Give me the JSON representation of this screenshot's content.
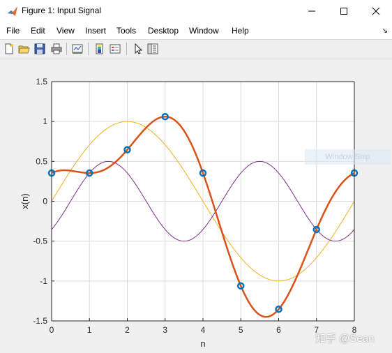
{
  "window": {
    "title": "Figure 1: Input Signal",
    "app_icon": "matlab-icon",
    "controls": [
      "minimize-icon",
      "maximize-icon",
      "close-icon"
    ]
  },
  "menu": {
    "items": [
      "File",
      "Edit",
      "View",
      "Insert",
      "Tools",
      "Desktop",
      "Window",
      "Help"
    ],
    "corner_glyph": "↘"
  },
  "toolbar": {
    "buttons": [
      "new-figure-icon",
      "open-file-icon",
      "save-icon",
      "print-icon",
      "link-plot-icon",
      "insert-colorbar-icon",
      "insert-legend-icon",
      "edit-plot-icon",
      "property-inspector-icon"
    ]
  },
  "overlay": {
    "snip_text": "Window Snip"
  },
  "watermark": {
    "text": "知乎 @Sean"
  },
  "chart_data": {
    "type": "line",
    "xlabel": "n",
    "ylabel": "x(n)",
    "xlim": [
      0,
      8
    ],
    "ylim": [
      -1.5,
      1.5
    ],
    "xticks": [
      0,
      1,
      2,
      3,
      4,
      5,
      6,
      7,
      8
    ],
    "yticks": [
      -1.5,
      -1,
      -0.5,
      0,
      0.5,
      1,
      1.5
    ],
    "ytick_labels": [
      "-1.5",
      "-1",
      "-0.5",
      "0",
      "0.5",
      "1",
      "1.5"
    ],
    "grid": true,
    "colors": {
      "sum": "#d95319",
      "sine_a": "#edb120",
      "sine_b": "#7e2f8e",
      "markers": "#0072bd"
    },
    "series": [
      {
        "key": "sine_a",
        "kind": "line",
        "formula": "sin(pi*n/4)",
        "color": "#edb120",
        "width": 1
      },
      {
        "key": "sine_b",
        "kind": "line",
        "formula": "0.5*cos(pi*n/2 - 3*pi/4)",
        "color": "#7e2f8e",
        "width": 1
      },
      {
        "key": "sum",
        "kind": "line",
        "formula": "interpolation through samples",
        "color": "#d95319",
        "width": 2.5
      },
      {
        "key": "samples",
        "kind": "stem-markers",
        "color": "#0072bd",
        "x": [
          0,
          1,
          2,
          3,
          4,
          5,
          6,
          7,
          8
        ],
        "y": [
          0.354,
          0.354,
          0.646,
          1.061,
          0.354,
          -1.061,
          -1.354,
          -0.354,
          0.354
        ]
      }
    ]
  }
}
